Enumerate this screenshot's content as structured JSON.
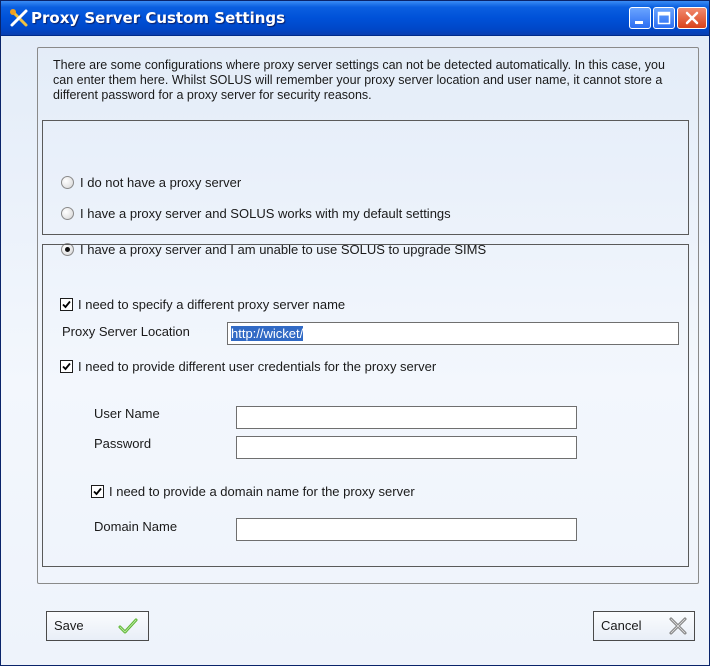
{
  "window": {
    "title": "Proxy Server Custom Settings"
  },
  "intro_text": "There are some configurations where proxy server settings can not be detected automatically.  In this case, you can enter them here.  Whilst SOLUS will remember your proxy server location and user name, it cannot store a different password for a proxy server for security reasons.",
  "proxy_mode": {
    "options": [
      {
        "label": "I do not have a proxy server",
        "selected": false
      },
      {
        "label": "I have a proxy server and SOLUS works with my default settings",
        "selected": false
      },
      {
        "label": "I have a proxy server and I am unable to use SOLUS to upgrade SIMS",
        "selected": true
      }
    ]
  },
  "custom": {
    "specify_name_label": "I need to specify a different proxy server name",
    "specify_name_checked": true,
    "location_label": "Proxy Server Location",
    "location_value": "http://wicket/",
    "credentials_label": "I need to provide different user credentials for the proxy server",
    "credentials_checked": true,
    "username_label": "User Name",
    "username_value": "",
    "password_label": "Password",
    "password_value": "",
    "domain_check_label": "I need to provide a domain name for the proxy server",
    "domain_checked": true,
    "domain_label": "Domain Name",
    "domain_value": ""
  },
  "buttons": {
    "save_label": "Save",
    "cancel_label": "Cancel"
  },
  "icons": {
    "app": "tools-icon",
    "save": "checkmark-icon",
    "cancel": "x-tool-icon"
  },
  "colors": {
    "titlebar": "#0051d8",
    "selection": "#316ac5",
    "save_check": "#5cb531"
  }
}
